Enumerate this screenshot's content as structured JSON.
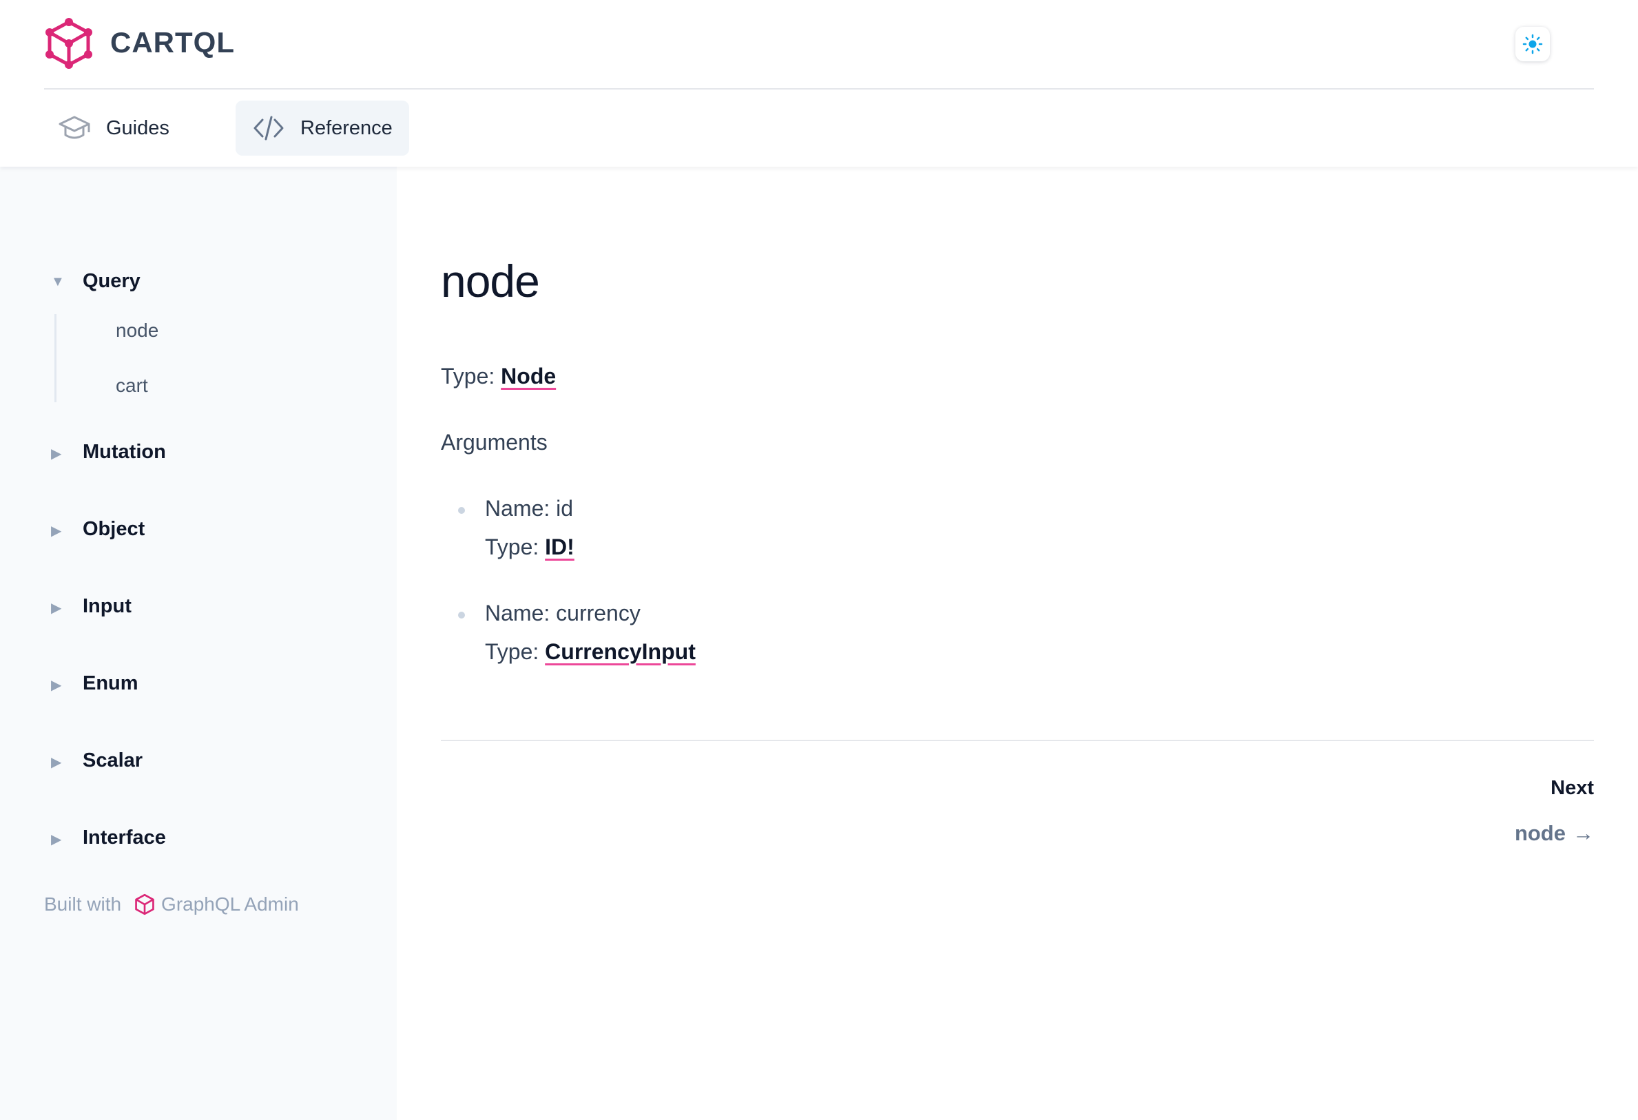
{
  "app": {
    "title": "CARTQL"
  },
  "tabs": [
    {
      "label": "Guides",
      "icon": "graduation-cap-icon",
      "active": false
    },
    {
      "label": "Reference",
      "icon": "code-icon",
      "active": true
    }
  ],
  "sidebar": {
    "groups": [
      {
        "label": "Query",
        "expanded": true,
        "items": [
          "node",
          "cart"
        ]
      },
      {
        "label": "Mutation",
        "expanded": false
      },
      {
        "label": "Object",
        "expanded": false
      },
      {
        "label": "Input",
        "expanded": false
      },
      {
        "label": "Enum",
        "expanded": false
      },
      {
        "label": "Scalar",
        "expanded": false
      },
      {
        "label": "Interface",
        "expanded": false
      }
    ],
    "footer": {
      "prefix": "Built with",
      "brand": "GraphQL Admin"
    }
  },
  "content": {
    "title": "node",
    "type_label": "Type:",
    "type_value": "Node",
    "arguments_heading": "Arguments",
    "arguments": [
      {
        "name_text": "Name: id",
        "type_label": "Type:",
        "type_value": "ID!"
      },
      {
        "name_text": "Name: currency",
        "type_label": "Type:",
        "type_value": "CurrencyInput"
      }
    ],
    "next": {
      "label": "Next",
      "link": "node",
      "arrow": "→"
    }
  },
  "colors": {
    "accent": "#db2777",
    "sun": "#0ea5e9",
    "sidebar_bg": "#f8fafc"
  }
}
